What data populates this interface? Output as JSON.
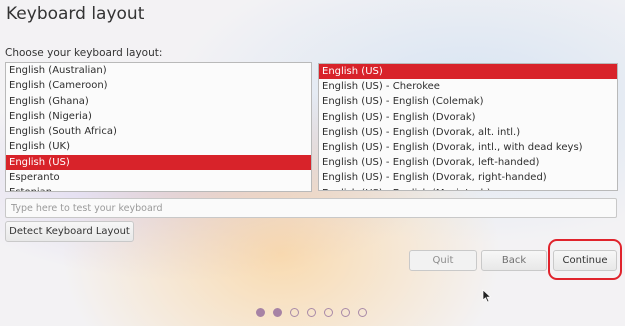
{
  "title": "Keyboard layout",
  "prompt": "Choose your keyboard layout:",
  "layouts": [
    {
      "label": "English (Australian)",
      "selected": false
    },
    {
      "label": "English (Cameroon)",
      "selected": false
    },
    {
      "label": "English (Ghana)",
      "selected": false
    },
    {
      "label": "English (Nigeria)",
      "selected": false
    },
    {
      "label": "English (South Africa)",
      "selected": false
    },
    {
      "label": "English (UK)",
      "selected": false
    },
    {
      "label": "English (US)",
      "selected": true
    },
    {
      "label": "Esperanto",
      "selected": false
    },
    {
      "label": "Estonian",
      "selected": false
    }
  ],
  "variants": [
    {
      "label": "English (US)",
      "selected": true
    },
    {
      "label": "English (US) - Cherokee",
      "selected": false
    },
    {
      "label": "English (US) - English (Colemak)",
      "selected": false
    },
    {
      "label": "English (US) - English (Dvorak)",
      "selected": false
    },
    {
      "label": "English (US) - English (Dvorak, alt. intl.)",
      "selected": false
    },
    {
      "label": "English (US) - English (Dvorak, intl., with dead keys)",
      "selected": false
    },
    {
      "label": "English (US) - English (Dvorak, left-handed)",
      "selected": false
    },
    {
      "label": "English (US) - English (Dvorak, right-handed)",
      "selected": false
    },
    {
      "label": "English (US) - English (Macintosh)",
      "selected": false
    }
  ],
  "test_input": {
    "placeholder": "Type here to test your keyboard",
    "value": ""
  },
  "buttons": {
    "detect": "Detect Keyboard Layout",
    "quit": "Quit",
    "back": "Back",
    "continue": "Continue"
  },
  "progress": {
    "total_steps": 7,
    "current_step": 2
  },
  "colors": {
    "selection": "#d8232a",
    "highlight_ring": "#e0232c",
    "progress_dot": "#a783a5"
  }
}
